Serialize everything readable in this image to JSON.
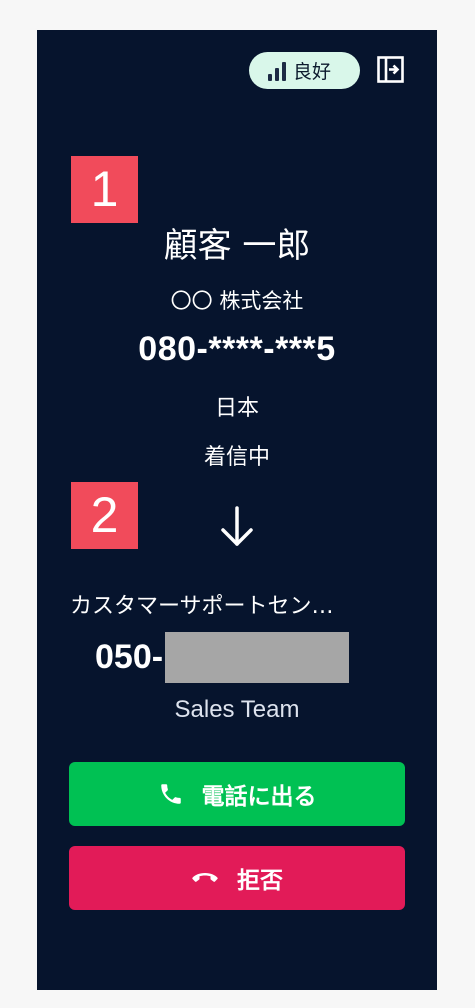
{
  "header": {
    "signal_quality": "良好"
  },
  "caller": {
    "badge": "1",
    "name": "顧客 一郎",
    "company": "〇〇 株式会社",
    "number": "080-****-***5",
    "country": "日本",
    "status": "着信中"
  },
  "destination": {
    "badge": "2",
    "name": "カスタマーサポートセン…",
    "number_prefix": "050-",
    "team": "Sales Team"
  },
  "actions": {
    "answer_label": "電話に出る",
    "reject_label": "拒否"
  },
  "colors": {
    "panel_bg": "#06142d",
    "badge": "#f14b5b",
    "answer": "#00c153",
    "reject": "#e21b58",
    "signal_pill": "#d9f7ea"
  },
  "icons": {
    "signal": "signal-bars-icon",
    "exit": "exit-panel-icon",
    "arrow": "arrow-down-icon",
    "answer": "phone-icon",
    "reject": "hang-up-icon"
  }
}
